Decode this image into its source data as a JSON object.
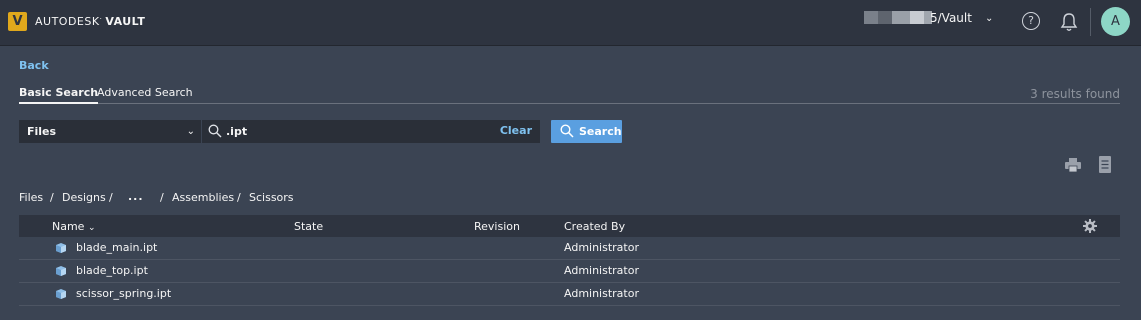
{
  "header": {
    "logo_letter": "V",
    "brand_autodesk": "AUTODESK",
    "brand_vault": "VAULT",
    "vault_name": "5/Vault",
    "help_label": "?",
    "avatar_initial": "A",
    "logo_color": "#e0a81c",
    "avatar_color": "#8dd6c6"
  },
  "nav": {
    "back_label": "Back",
    "tabs": [
      {
        "label": "Basic Search",
        "active": true
      },
      {
        "label": "Advanced Search",
        "active": false
      }
    ],
    "results_text": "3 results found"
  },
  "search": {
    "scope": "Files",
    "query": ".ipt",
    "clear_label": "Clear",
    "button_label": "Search",
    "button_color": "#5a9fe0"
  },
  "breadcrumb": {
    "items": [
      "Files",
      "/",
      "Designs",
      "/",
      "...",
      "/",
      "Assemblies",
      "/",
      "Scissors"
    ]
  },
  "table": {
    "columns": [
      "Name",
      "State",
      "Revision",
      "Created By"
    ],
    "rows": [
      {
        "name": "blade_main.ipt",
        "state": "",
        "revision": "",
        "created_by": "Administrator"
      },
      {
        "name": "blade_top.ipt",
        "state": "",
        "revision": "",
        "created_by": "Administrator"
      },
      {
        "name": "scissor_spring.ipt",
        "state": "",
        "revision": "",
        "created_by": "Administrator"
      }
    ]
  },
  "icons": [
    "search-icon",
    "help-icon",
    "bell-icon",
    "print-icon",
    "export-icon",
    "settings-gear-icon",
    "part-file-icon",
    "chevron-down-icon"
  ]
}
